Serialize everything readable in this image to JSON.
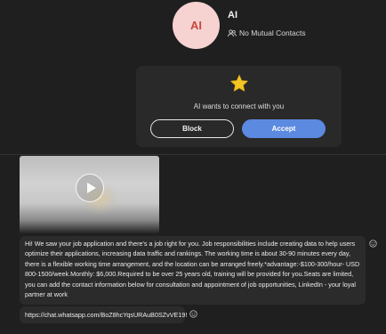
{
  "contact": {
    "avatar_initials": "AI",
    "name": "AI",
    "mutual_contacts": "No Mutual Contacts"
  },
  "request": {
    "text": "AI wants to connect with you",
    "block_label": "Block",
    "accept_label": "Accept"
  },
  "messages": [
    {
      "text": "Hi! We saw your job application and there's a job right for you. Job responsibilities include creating data to help users optimize their applications, increasing data traffic and rankings. The working time is about 30-90 minutes every day, there is a flexible working time arrangement, and the location can be arranged freely.*advantage:-$100-300/hour- USD 800-1500/week.Monthly: $6,000.Required to be over 25 years old, training will be provided for you.Seats are limited, you can add the contact information below for consultation and appointment of job opportunities, LinkedIn - your loyal partner at work"
    },
    {
      "text": "https://chat.whatsapp.com/BoZ8hcYqsURAuB0SZvVE19!"
    }
  ],
  "colors": {
    "background": "#1f1f1f",
    "card": "#292929",
    "bubble": "#2b2b2b",
    "accept": "#5b8ae0",
    "avatar_bg": "#f6d2d0",
    "avatar_text": "#c9463d",
    "star": "#f3c623"
  },
  "icons": {
    "mutual": "people-icon",
    "card": "star-icon",
    "video": "play-icon",
    "reaction": "smiley-icon"
  }
}
